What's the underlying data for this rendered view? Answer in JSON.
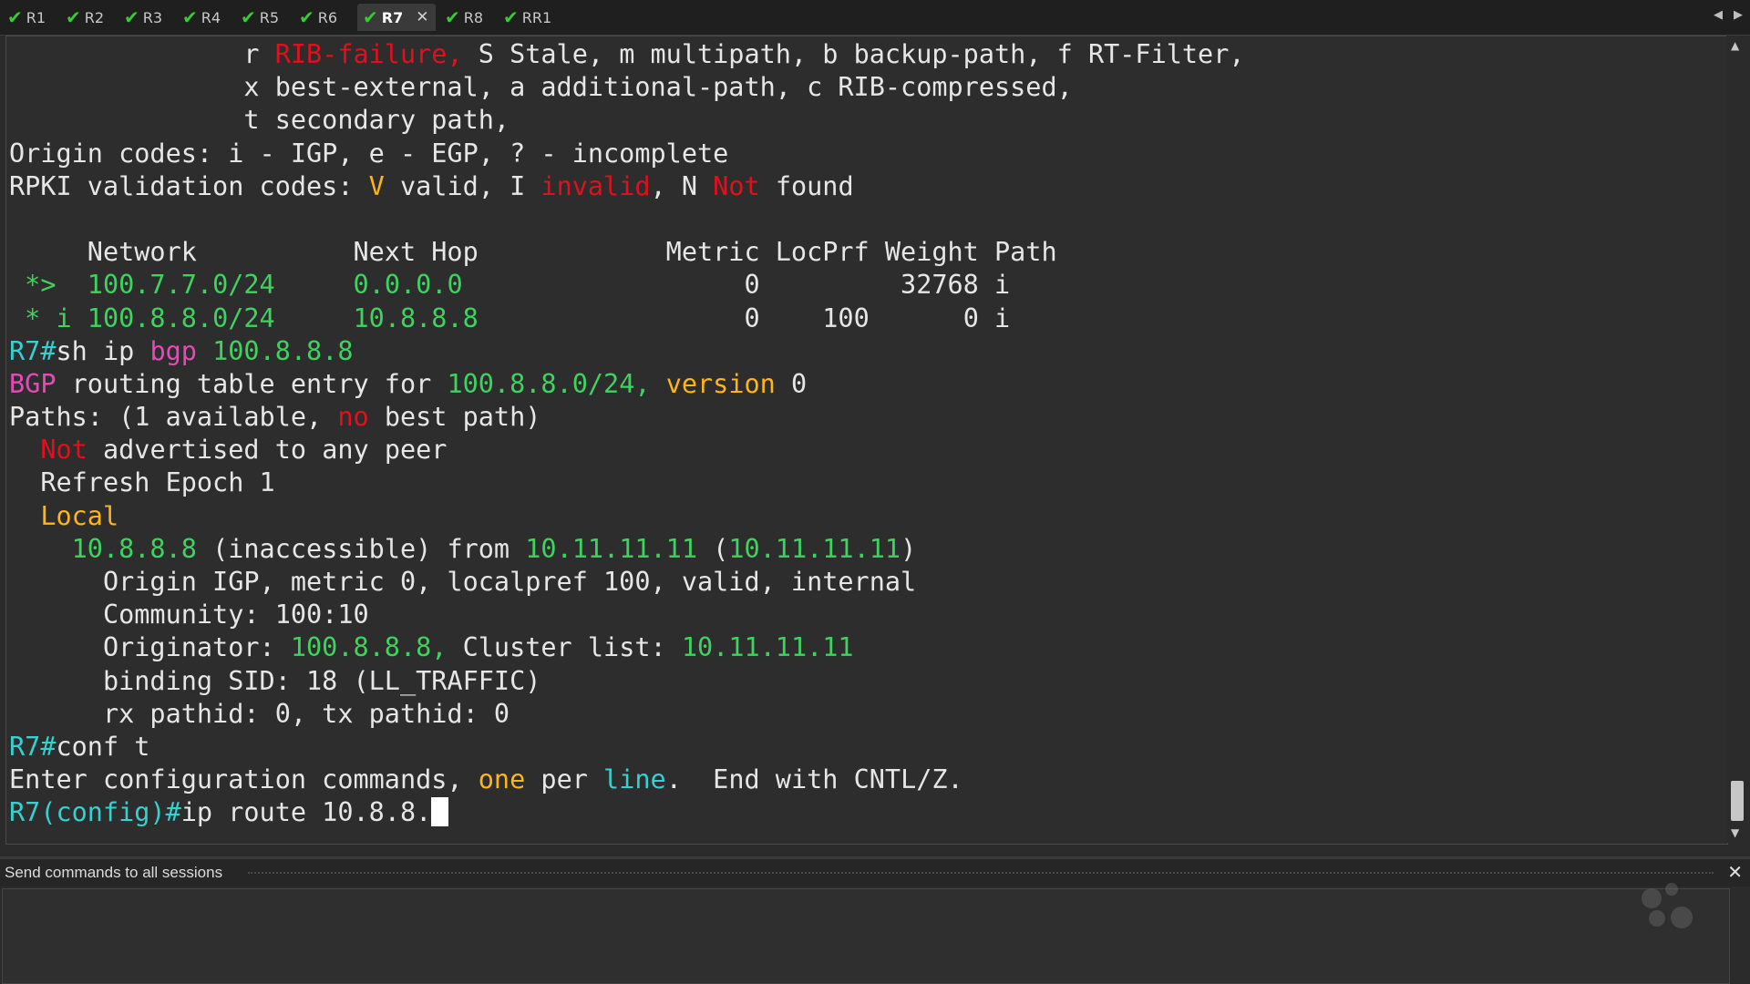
{
  "tabs": [
    {
      "label": "R1",
      "active": false
    },
    {
      "label": "R2",
      "active": false
    },
    {
      "label": "R3",
      "active": false
    },
    {
      "label": "R4",
      "active": false
    },
    {
      "label": "R5",
      "active": false
    },
    {
      "label": "R6",
      "active": false
    },
    {
      "label": "R7",
      "active": true
    },
    {
      "label": "R8",
      "active": false
    },
    {
      "label": "RR1",
      "active": false
    }
  ],
  "tab_icons": {
    "status": "check-icon",
    "close": "close-icon"
  },
  "colors": {
    "green": "#3ed25f",
    "cyan": "#35d0d0",
    "pink": "#e74ab8",
    "yellow": "#ffb417",
    "red": "#e0101c",
    "text": "#e6e6e6",
    "background": "#2d2d2d"
  },
  "terminal": {
    "lines": [
      [
        {
          "t": "               r "
        },
        {
          "t": "RIB-failure,",
          "c": "r"
        },
        {
          "t": " S Stale, m multipath, b backup-path, f RT-Filter,"
        }
      ],
      [
        {
          "t": "               x best-external, a additional-path, c RIB-compressed,"
        }
      ],
      [
        {
          "t": "               t secondary path,"
        }
      ],
      [
        {
          "t": "Origin codes: i - IGP, e - EGP, ? - incomplete"
        }
      ],
      [
        {
          "t": "RPKI validation codes: "
        },
        {
          "t": "V",
          "c": "y"
        },
        {
          "t": " valid, I "
        },
        {
          "t": "invalid",
          "c": "r"
        },
        {
          "t": ", N "
        },
        {
          "t": "Not",
          "c": "r"
        },
        {
          "t": " found"
        }
      ],
      [
        {
          "t": ""
        }
      ],
      [
        {
          "t": "     Network          Next Hop            Metric LocPrf Weight Path"
        }
      ],
      [
        {
          "t": " *>  ",
          "c": "g"
        },
        {
          "t": "100.7.7.0/24",
          "c": "g"
        },
        {
          "t": "     "
        },
        {
          "t": "0.0.0.0",
          "c": "g"
        },
        {
          "t": "                  0         32768 i"
        }
      ],
      [
        {
          "t": " * i ",
          "c": "g"
        },
        {
          "t": "100.8.8.0/24",
          "c": "g"
        },
        {
          "t": "     "
        },
        {
          "t": "10.8.8.8",
          "c": "g"
        },
        {
          "t": "                 0    100      0 i"
        }
      ],
      [
        {
          "t": "R7#",
          "c": "c"
        },
        {
          "t": "sh ip "
        },
        {
          "t": "bgp",
          "c": "p"
        },
        {
          "t": " "
        },
        {
          "t": "100.8.8.8",
          "c": "g"
        }
      ],
      [
        {
          "t": "BGP",
          "c": "p"
        },
        {
          "t": " routing table entry for "
        },
        {
          "t": "100.8.8.0/24,",
          "c": "g"
        },
        {
          "t": " "
        },
        {
          "t": "version",
          "c": "y"
        },
        {
          "t": " 0"
        }
      ],
      [
        {
          "t": "Paths: (1 available, "
        },
        {
          "t": "no",
          "c": "r"
        },
        {
          "t": " best path)"
        }
      ],
      [
        {
          "t": "  "
        },
        {
          "t": "Not",
          "c": "r"
        },
        {
          "t": " advertised to any peer"
        }
      ],
      [
        {
          "t": "  Refresh Epoch 1"
        }
      ],
      [
        {
          "t": "  "
        },
        {
          "t": "Local",
          "c": "y"
        }
      ],
      [
        {
          "t": "    "
        },
        {
          "t": "10.8.8.8",
          "c": "g"
        },
        {
          "t": " (inaccessible) from "
        },
        {
          "t": "10.11.11.11",
          "c": "g"
        },
        {
          "t": " ("
        },
        {
          "t": "10.11.11.11",
          "c": "g"
        },
        {
          "t": ")"
        }
      ],
      [
        {
          "t": "      Origin IGP, metric 0, localpref 100, valid, internal"
        }
      ],
      [
        {
          "t": "      Community: 100:10"
        }
      ],
      [
        {
          "t": "      Originator: "
        },
        {
          "t": "100.8.8.8,",
          "c": "g"
        },
        {
          "t": " Cluster list: "
        },
        {
          "t": "10.11.11.11",
          "c": "g"
        }
      ],
      [
        {
          "t": "      binding SID: 18 (LL_TRAFFIC)"
        }
      ],
      [
        {
          "t": "      rx pathid: 0, tx pathid: 0"
        }
      ],
      [
        {
          "t": "R7#",
          "c": "c"
        },
        {
          "t": "conf t"
        }
      ],
      [
        {
          "t": "Enter configuration commands, "
        },
        {
          "t": "one",
          "c": "y"
        },
        {
          "t": " per "
        },
        {
          "t": "line",
          "c": "c"
        },
        {
          "t": ".  End with CNTL/Z."
        }
      ],
      [
        {
          "t": "R7(config)#",
          "c": "c"
        },
        {
          "t": "ip route 10.8.8."
        },
        {
          "cursor": true
        }
      ]
    ]
  },
  "send_panel": {
    "title": "Send commands to all sessions",
    "input_value": ""
  }
}
